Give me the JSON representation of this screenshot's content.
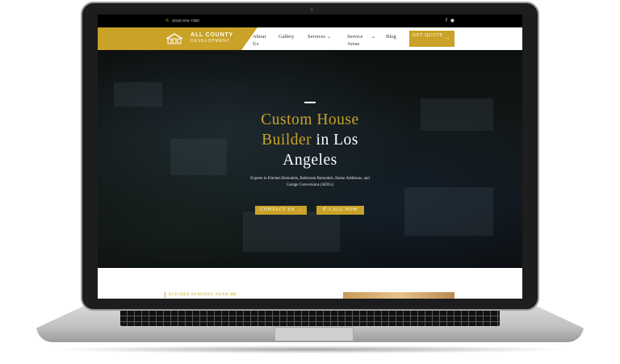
{
  "topbar": {
    "phone": "(818) 815-7380"
  },
  "logo": {
    "title": "ALL COUNTY",
    "subtitle": "DEVELOPMENT"
  },
  "nav": {
    "items": [
      {
        "label": "About Us"
      },
      {
        "label": "Gallery"
      },
      {
        "label": "Services"
      },
      {
        "label": "Service Areas"
      },
      {
        "label": "Blog"
      }
    ],
    "cta": "GET QUOTE"
  },
  "hero": {
    "title_line1": "Custom House",
    "title_gold2": "Builder",
    "title_white2": " in Los",
    "title_line3": "Angeles",
    "subtitle": "Experts in Kitchen Remodels, Bathroom Remodels, Home Additions, and Garage Conversions (ADUs)",
    "contact_button": "CONTACT US",
    "call_button": "CALL NOW"
  },
  "section": {
    "label": "KITCHEN REMODEL NEAR ME"
  },
  "colors": {
    "accent": "#c9a227",
    "dark": "#000000"
  },
  "icons": [
    "phone-icon",
    "facebook-icon",
    "instagram-icon",
    "chevron-down-icon",
    "arrow-right-icon"
  ]
}
